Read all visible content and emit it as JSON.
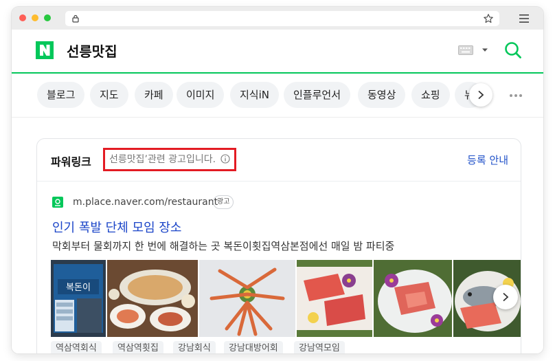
{
  "browser": {
    "lock_icon": "lock-icon",
    "bookmark_icon": "star-icon",
    "menu_icon": "hamburger-menu-icon"
  },
  "header": {
    "logo_letter": "N",
    "query": "선릉맛집",
    "brand_color": "#03c75a"
  },
  "tabs": {
    "items": [
      "블로그",
      "지도",
      "카페",
      "이미지",
      "지식iN",
      "인플루언서",
      "동영상",
      "쇼핑",
      "뉴"
    ]
  },
  "powerlink": {
    "title": "파워링크",
    "notice": "선릉맛집’관련 광고입니다.",
    "register_link": "등록 안내",
    "highlight_color": "#e31b23"
  },
  "ad": {
    "url": "m.place.naver.com/restaurant",
    "badge": "광고",
    "headline": "인기 폭발 단체 모임 장소",
    "description": "막회부터 물회까지 한 번에 해결하는 곳 복돈이횟집역삼본점에선 매일 밤 파티중",
    "storefront_sign": "복돈이",
    "keywords": [
      "역삼역회식",
      "역삼역횟집",
      "강남회식",
      "강남대방어회",
      "강남역모임"
    ]
  }
}
